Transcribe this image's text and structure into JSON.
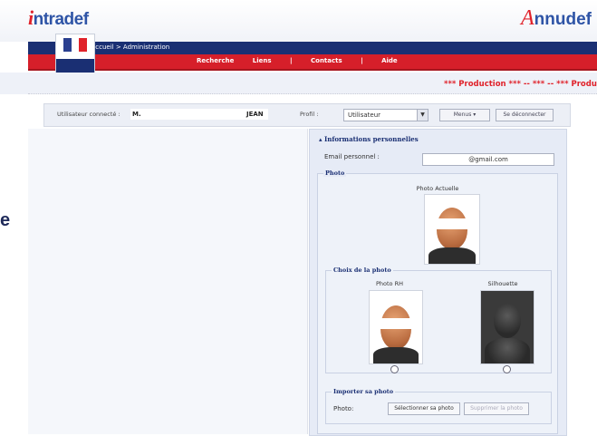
{
  "header": {
    "logo_left_glyph": "i",
    "logo_left_text": "ntradef",
    "logo_right_glyph": "A",
    "logo_right_text": "nnudef",
    "breadcrumb": "accueil > Administration",
    "nav": [
      "Recherche",
      "Liens",
      "|",
      "Contacts",
      "|",
      "Aide"
    ],
    "production_banner": "*** Production *** -- *** -- *** Production",
    "partial_text": "e"
  },
  "userbar": {
    "connected_label": "Utilisateur connecté :",
    "user_prefix": "M.",
    "user_lastname": "JEAN",
    "profile_label": "Profil :",
    "profile_value": "Utilisateur",
    "menu_button": "Menus",
    "logout_button": "Se déconnecter"
  },
  "personal_info": {
    "title": "Informations personnelles",
    "email_label": "Email personnel :",
    "email_value": "@gmail.com",
    "photo_legend": "Photo",
    "current_photo_label": "Photo Actuelle",
    "choice_legend": "Choix de la photo",
    "photo_rh_label": "Photo RH",
    "silhouette_label": "Silhouette",
    "import_legend": "Importer sa photo",
    "import_label": "Photo:",
    "select_photo_button": "Sélectionner sa photo",
    "delete_photo_button": "Supprimer la photo"
  },
  "colors": {
    "brand_blue": "#1a2f73",
    "brand_red": "#d61f2a"
  }
}
